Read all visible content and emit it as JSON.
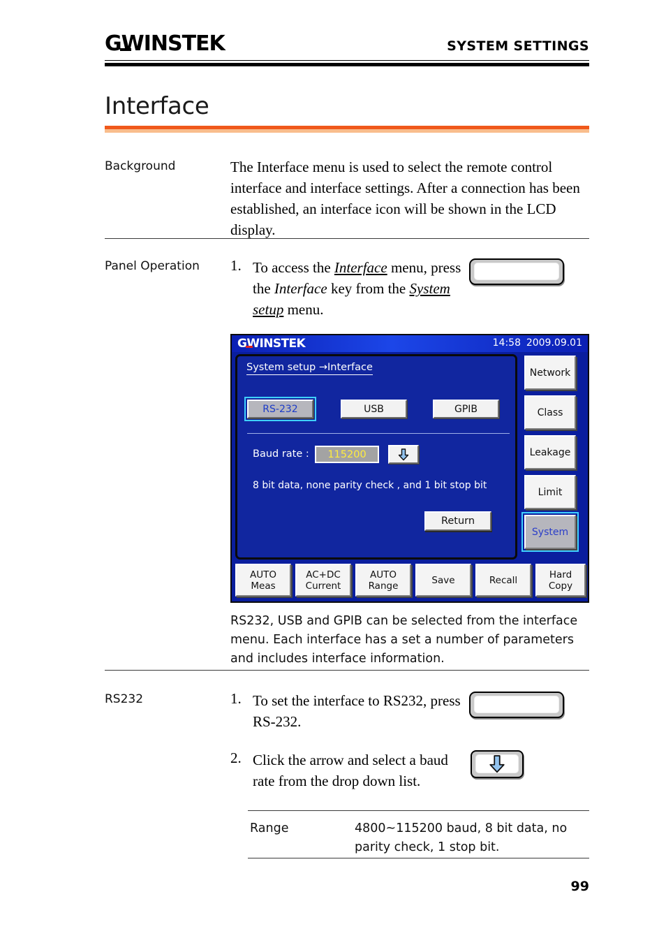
{
  "header": {
    "logo_gw": "G",
    "logo_w": "W",
    "logo_rest": "INSTEK",
    "section_title": "SYSTEM SETTINGS"
  },
  "chapter": {
    "title": "Interface"
  },
  "page_number": "99",
  "sections": {
    "background": {
      "label": "Background",
      "text": "The Interface menu is used to select the remote control interface and interface settings. After a connection has been established, an interface icon will be shown in the LCD display."
    },
    "panel_operation": {
      "label": "Panel Operation",
      "step1_number": "1.",
      "step1_part1": "To access the ",
      "step1_em1": "Interface",
      "step1_part2": " menu, press the ",
      "step1_em2": "Interface",
      "step1_part3": " key from the ",
      "step1_em3": "System setup",
      "step1_part4": " menu.",
      "caption": "RS232, USB and GPIB can be selected from the interface menu. Each interface has a set a number of parameters and includes interface information."
    },
    "rs232": {
      "label": "RS232",
      "step1_number": "1.",
      "step1_text": "To set the interface to RS232, press RS-232.",
      "step2_number": "2.",
      "step2_text": "Click the arrow and select a baud rate from the drop down list.",
      "range_label": "Range",
      "range_value": "4800~115200 baud, 8 bit data, no parity check, 1 stop bit."
    }
  },
  "lcd": {
    "logo": "GWINSTEK",
    "time": "14:58",
    "date": "2009.09.01",
    "breadcrumb": "System setup →Interface",
    "interface_buttons": [
      {
        "label": "RS-232",
        "selected": true
      },
      {
        "label": "USB",
        "selected": false
      },
      {
        "label": "GPIB",
        "selected": false
      }
    ],
    "baud_label": "Baud rate :",
    "baud_value": "115200",
    "dropdown_icon": "down-arrow-icon",
    "note": "8 bit data, none parity check , and 1 bit stop bit",
    "return_button": "Return",
    "side_keys": [
      {
        "label": "Network",
        "selected": false
      },
      {
        "label": "Class",
        "selected": false
      },
      {
        "label": "Leakage",
        "selected": false
      },
      {
        "label": "Limit",
        "selected": false
      },
      {
        "label": "System",
        "selected": true
      }
    ],
    "function_keys": [
      {
        "line1": "AUTO",
        "line2": "Meas"
      },
      {
        "line1": "AC+DC",
        "line2": "Current"
      },
      {
        "line1": "AUTO",
        "line2": "Range"
      },
      {
        "line1": "Save",
        "line2": ""
      },
      {
        "line1": "Recall",
        "line2": ""
      },
      {
        "line1": "Hard",
        "line2": "Copy"
      }
    ],
    "colors": {
      "screen_blue": "#0a1e9e",
      "panel_blue": "#11269f",
      "titlebar_blue": "#1c46e8",
      "selected_glow": "#3fd0ff",
      "baud_yellow": "#ffec3d",
      "logo_red": "#e02020"
    }
  },
  "panel_keys": {
    "blank_key_1": "",
    "blank_key_2": "",
    "down_arrow_key": "down-arrow-icon"
  },
  "colors": {
    "accent_orange": "#f0591b",
    "accent_orange_light": "#f9bd8c"
  }
}
